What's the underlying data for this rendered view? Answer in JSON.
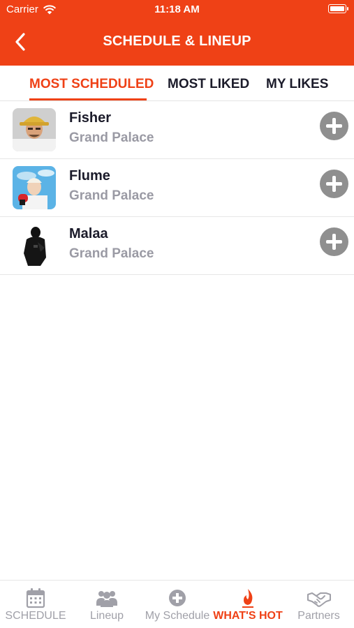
{
  "status_bar": {
    "carrier": "Carrier",
    "time": "11:18 AM"
  },
  "nav": {
    "title": "SCHEDULE & LINEUP",
    "back_icon": "chevron-left-icon"
  },
  "tabs": [
    {
      "label": "MOST SCHEDULED",
      "active": true
    },
    {
      "label": "MOST LIKED",
      "active": false
    },
    {
      "label": "MY LIKES",
      "active": false
    }
  ],
  "artists": [
    {
      "name": "Fisher",
      "venue": "Grand Palace"
    },
    {
      "name": "Flume",
      "venue": "Grand Palace"
    },
    {
      "name": "Malaa",
      "venue": "Grand Palace"
    }
  ],
  "tab_bar": [
    {
      "label": "SCHEDULE",
      "icon": "calendar-icon",
      "active": false
    },
    {
      "label": "Lineup",
      "icon": "people-icon",
      "active": false
    },
    {
      "label": "My Schedule",
      "icon": "plus-circle-icon",
      "active": false
    },
    {
      "label": "WHAT'S HOT",
      "icon": "flame-icon",
      "active": true
    },
    {
      "label": "Partners",
      "icon": "handshake-icon",
      "active": false
    }
  ],
  "colors": {
    "accent": "#ef4116",
    "inactive": "#a0a0a8",
    "add_button": "#8f8f8f"
  }
}
